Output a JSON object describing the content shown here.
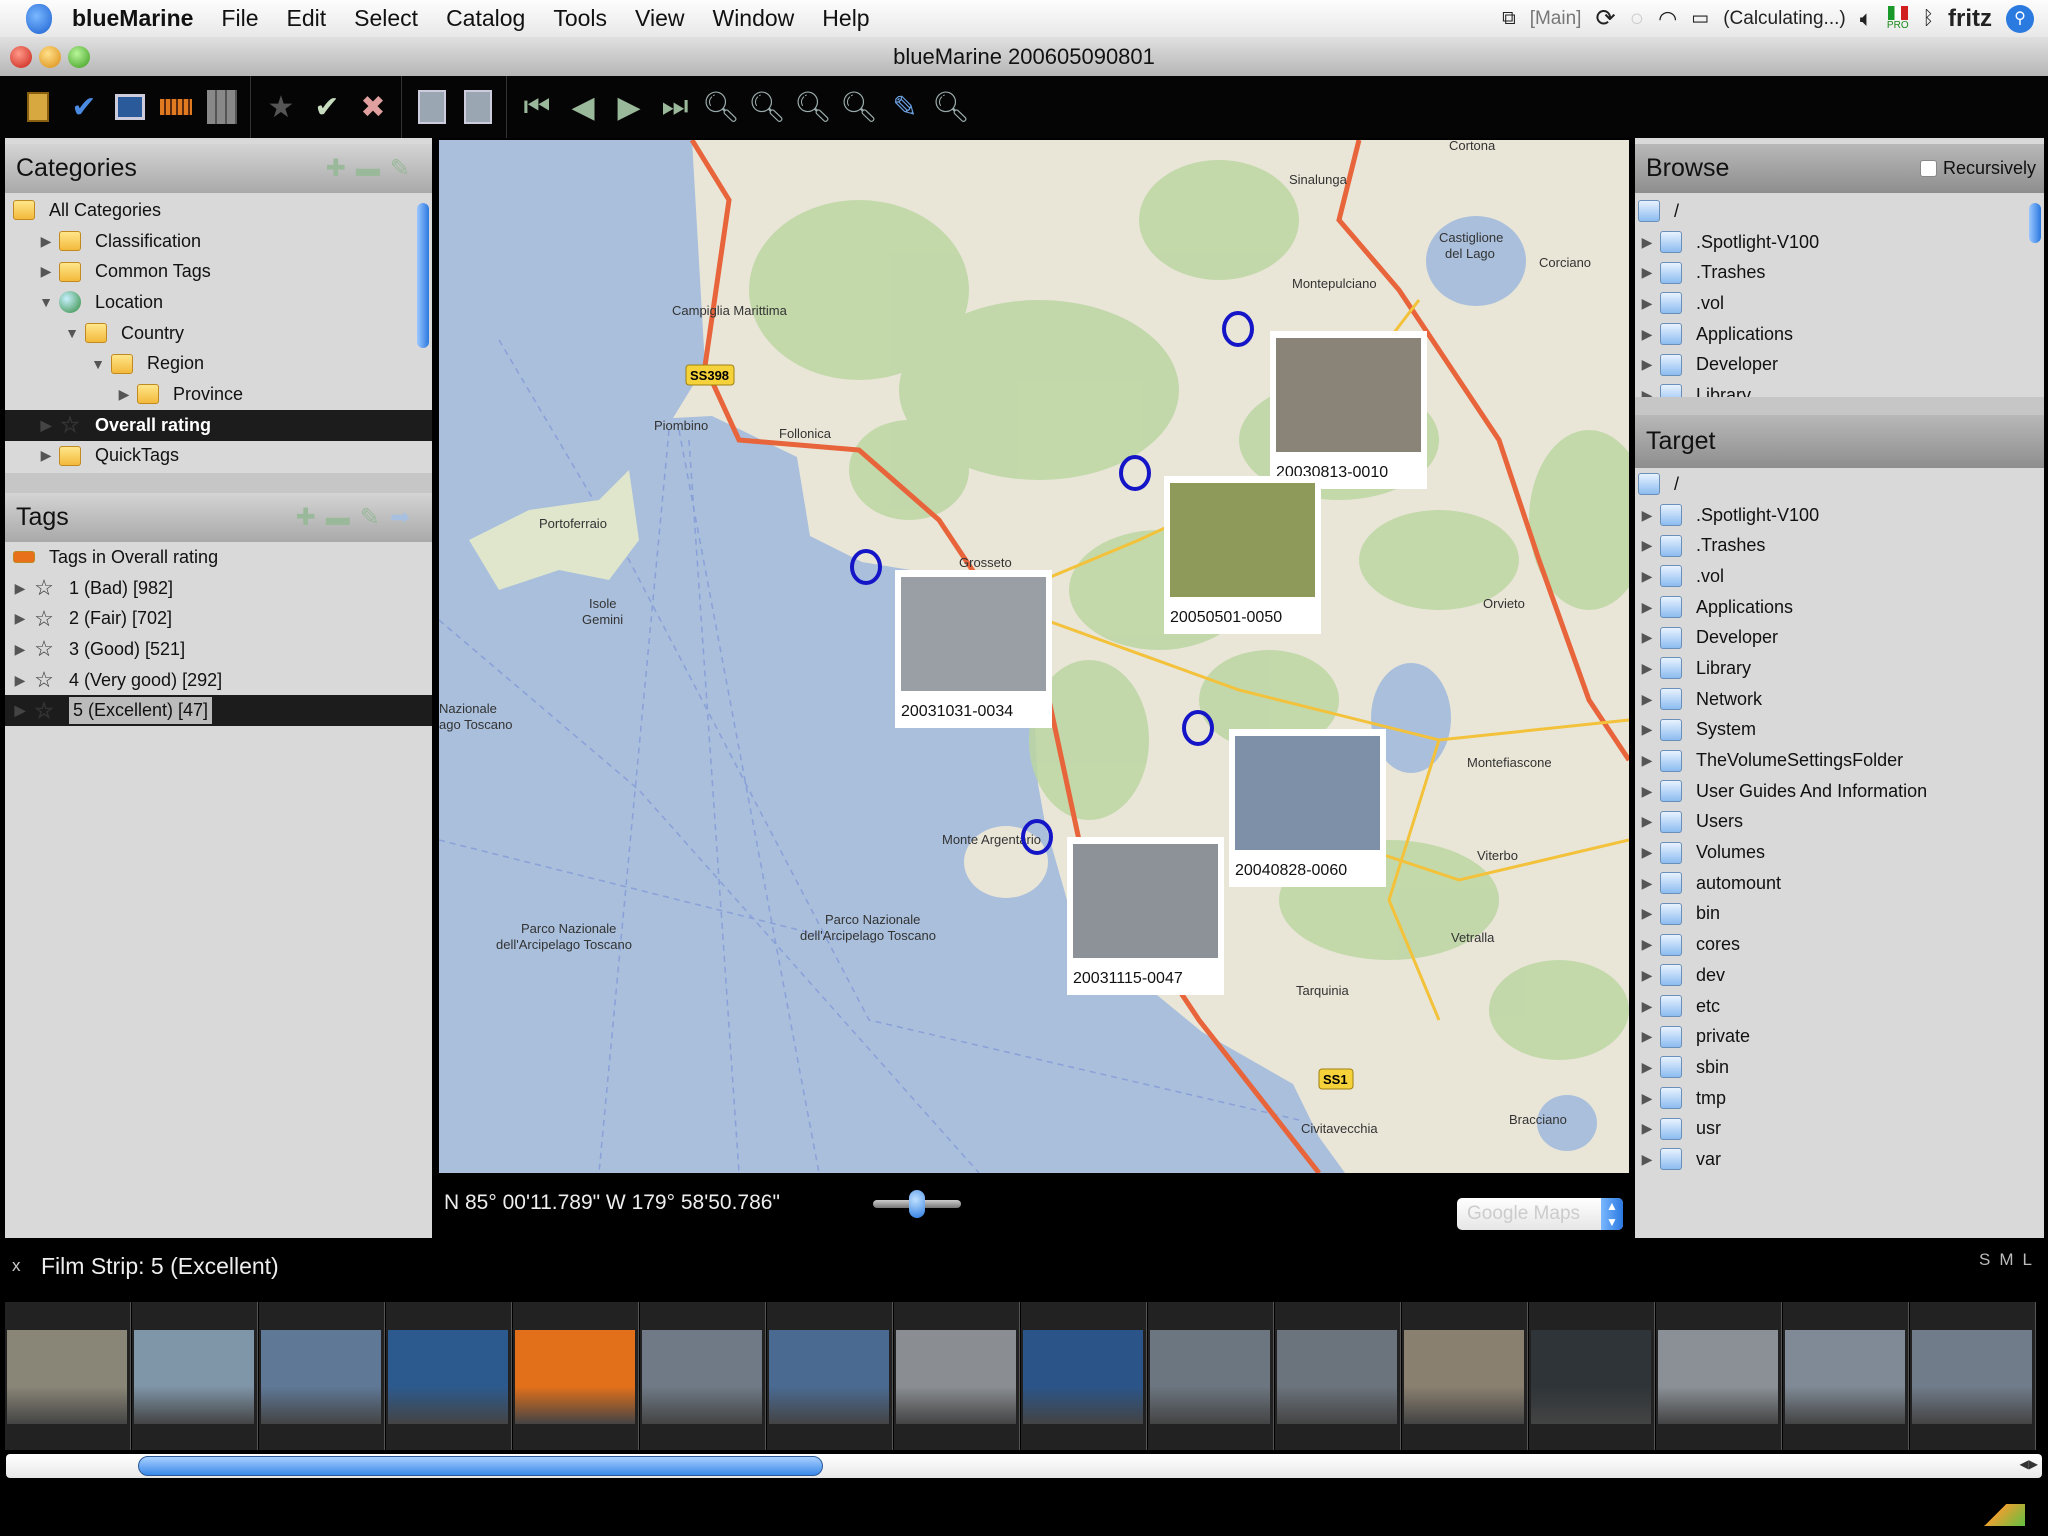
{
  "menubar": {
    "app": "blueMarine",
    "items": [
      "File",
      "Edit",
      "Select",
      "Catalog",
      "Tools",
      "View",
      "Window",
      "Help"
    ],
    "status": {
      "main": "[Main]",
      "battery": "(Calculating...)",
      "flag_badge": "PRO",
      "user": "fritz"
    }
  },
  "window": {
    "title": "blueMarine 200605090801"
  },
  "categories": {
    "title": "Categories",
    "items": [
      {
        "label": "All Categories",
        "level": 0,
        "icon": "folder",
        "toggle": ""
      },
      {
        "label": "Classification",
        "level": 1,
        "icon": "folder",
        "toggle": "▶"
      },
      {
        "label": "Common Tags",
        "level": 1,
        "icon": "folder",
        "toggle": "▶"
      },
      {
        "label": "Location",
        "level": 1,
        "icon": "globe",
        "toggle": "▼"
      },
      {
        "label": "Country",
        "level": 2,
        "icon": "folder",
        "toggle": "▼"
      },
      {
        "label": "Region",
        "level": 3,
        "icon": "folder",
        "toggle": "▼"
      },
      {
        "label": "Province",
        "level": 4,
        "icon": "folder",
        "toggle": "▶"
      },
      {
        "label": "Overall rating",
        "level": 1,
        "icon": "star",
        "toggle": "▶",
        "selected": true
      },
      {
        "label": "QuickTags",
        "level": 1,
        "icon": "folder",
        "toggle": "▶"
      }
    ]
  },
  "tags": {
    "title": "Tags",
    "items": [
      {
        "label": "Tags in Overall rating",
        "level": 0,
        "icon": "tag",
        "toggle": ""
      },
      {
        "label": "1 (Bad) [982]",
        "level": 1,
        "icon": "star",
        "toggle": "▶"
      },
      {
        "label": "2 (Fair) [702]",
        "level": 1,
        "icon": "star",
        "toggle": "▶"
      },
      {
        "label": "3 (Good) [521]",
        "level": 1,
        "icon": "star",
        "toggle": "▶"
      },
      {
        "label": "4 (Very good) [292]",
        "level": 1,
        "icon": "star",
        "toggle": "▶"
      },
      {
        "label": "5 (Excellent) [47]",
        "level": 1,
        "icon": "star",
        "toggle": "▶",
        "selected": true
      }
    ]
  },
  "browse": {
    "title": "Browse",
    "recursively_label": "Recursively",
    "recursively_checked": false,
    "items": [
      "/",
      ".Spotlight-V100",
      ".Trashes",
      ".vol",
      "Applications",
      "Developer",
      "Library"
    ]
  },
  "target": {
    "title": "Target",
    "items": [
      "/",
      ".Spotlight-V100",
      ".Trashes",
      ".vol",
      "Applications",
      "Developer",
      "Library",
      "Network",
      "System",
      "TheVolumeSettingsFolder",
      "User Guides And Information",
      "Users",
      "Volumes",
      "automount",
      "bin",
      "cores",
      "dev",
      "etc",
      "private",
      "sbin",
      "tmp",
      "usr",
      "var"
    ]
  },
  "map": {
    "labels": [
      "Cortona",
      "Sinalunga",
      "Castiglione",
      "del Lago",
      "Corciano",
      "Montepulciano",
      "Campiglia Marittima",
      "Piombino",
      "Follonica",
      "Portoferraio",
      "Grosseto",
      "Isole",
      "Gemini",
      "Orvieto",
      "Nazionale",
      "ago Toscano",
      "Montefiascone",
      "Monte Argentario",
      "Viterbo",
      "Parco Nazionale",
      "dell'Arcipelago Toscano",
      "Parco Nazionale",
      "dell'Arcipelago Toscano",
      "Vetralla",
      "Tarquinia",
      "Bracciano",
      "Civitavecchia"
    ],
    "road_badges": [
      "SS398",
      "SS1"
    ],
    "photos": [
      {
        "id": "20030813-0010",
        "color": "#8a8478"
      },
      {
        "id": "20050501-0050",
        "color": "#8e9a5a"
      },
      {
        "id": "20031031-0034",
        "color": "#9a9fa6"
      },
      {
        "id": "20040828-0060",
        "color": "#7d90a8"
      },
      {
        "id": "20031115-0047",
        "color": "#8d9299"
      }
    ],
    "coords": "N 85° 00'11.789\" W 179° 58'50.786\"",
    "provider": "Google Maps"
  },
  "filmstrip": {
    "close": "x",
    "title": "Film Strip: 5 (Excellent)",
    "sizes": [
      "S",
      "M",
      "L"
    ],
    "thumbs": [
      "#8a8677",
      "#7f95a8",
      "#5f7896",
      "#2d5a8e",
      "#e2701a",
      "#6f7a86",
      "#4a6a92",
      "#8a8e92",
      "#2b5588",
      "#6c7680",
      "#6b737c",
      "#8a8070",
      "#2e3438",
      "#8a9096",
      "#7f8a96",
      "#707c8a"
    ],
    "scroll_position": 0.3
  }
}
